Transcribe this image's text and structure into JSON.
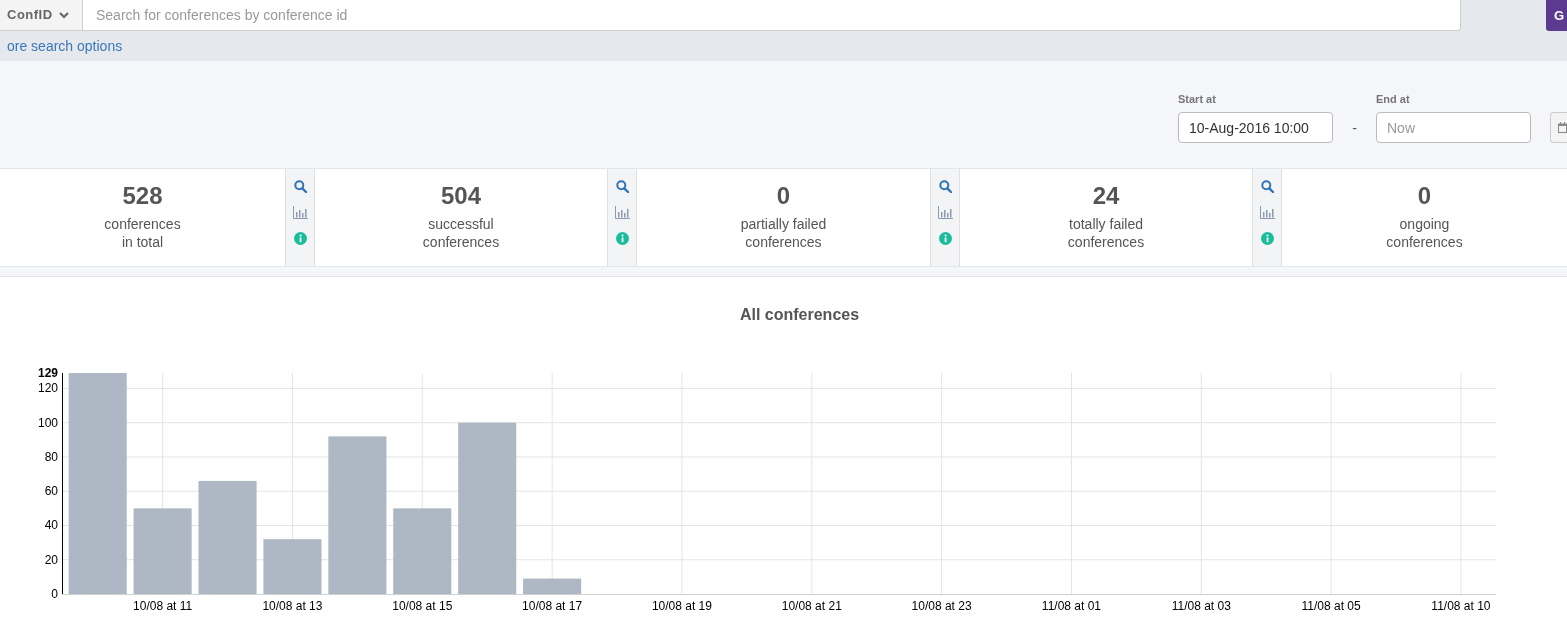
{
  "search_bar": {
    "filter_label": "ConfID",
    "placeholder": "Search for conferences by conference id",
    "go_button": "G"
  },
  "more_search_options_link": "ore search options",
  "date_range": {
    "start_label": "Start at",
    "start_value": "10-Aug-2016 10:00",
    "separator": "-",
    "end_label": "End at",
    "end_placeholder": "Now"
  },
  "stats": [
    {
      "value": "528",
      "label": "conferences\nin total"
    },
    {
      "value": "504",
      "label": "successful\nconferences"
    },
    {
      "value": "0",
      "label": "partially failed\nconferences"
    },
    {
      "value": "24",
      "label": "totally failed\nconferences"
    },
    {
      "value": "0",
      "label": "ongoing\nconferences"
    }
  ],
  "chart": {
    "title": "All conferences",
    "chart_data": {
      "type": "bar",
      "categories": [
        null,
        "10/08 at 11",
        null,
        "10/08 at 13",
        null,
        "10/08 at 15",
        null,
        "10/08 at 17",
        null,
        "10/08 at 19",
        null,
        "10/08 at 21",
        null,
        "10/08 at 23",
        null,
        "11/08 at 01",
        null,
        "11/08 at 03",
        null,
        "11/08 at 05",
        null,
        "11/08 at 10"
      ],
      "series": [
        {
          "color": "#aeb8c5",
          "values": [
            129,
            50,
            66,
            32,
            92,
            50,
            100,
            9,
            null,
            null,
            null,
            null,
            null,
            null,
            null,
            null,
            null,
            null,
            null,
            null,
            null,
            null
          ]
        }
      ],
      "ylim": [
        0,
        129
      ],
      "yticks": [
        0,
        20,
        40,
        60,
        80,
        100,
        120,
        129
      ],
      "grid": true
    }
  }
}
